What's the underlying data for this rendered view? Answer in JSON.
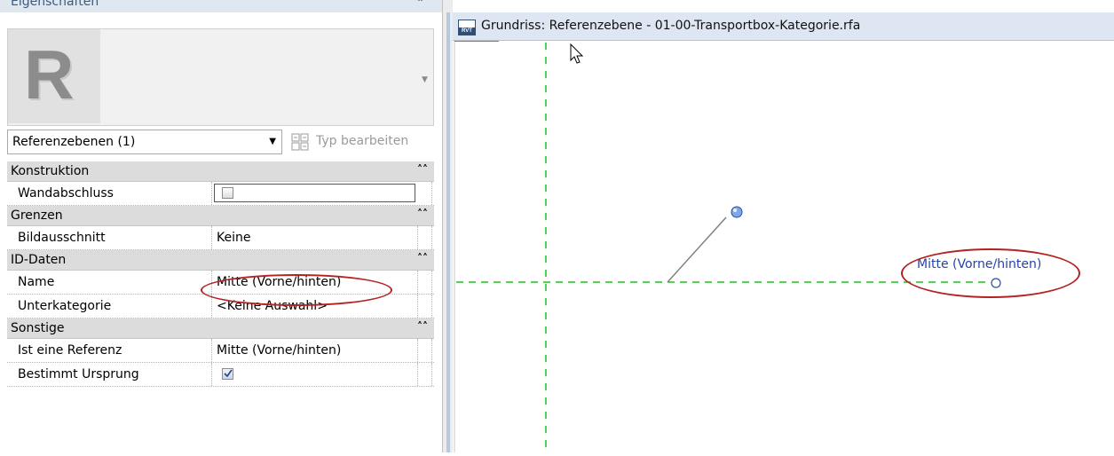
{
  "properties_panel": {
    "title": "Eigenschaften",
    "type_selector": {
      "value": "Referenzebenen (1)"
    },
    "edit_type_label": "Typ bearbeiten",
    "groups": [
      {
        "name": "Konstruktion",
        "rows": [
          {
            "name": "Wandabschluss",
            "checked": false
          }
        ]
      },
      {
        "name": "Grenzen",
        "rows": [
          {
            "name": "Bildausschnitt",
            "value": "Keine"
          }
        ]
      },
      {
        "name": "ID-Daten",
        "rows": [
          {
            "name": "Name",
            "value": "Mitte (Vorne/hinten)"
          },
          {
            "name": "Unterkategorie",
            "value": "<Keine Auswahl>"
          }
        ]
      },
      {
        "name": "Sonstige",
        "rows": [
          {
            "name": "Ist eine Referenz",
            "value": "Mitte (Vorne/hinten)"
          },
          {
            "name": "Bestimmt Ursprung",
            "checked": true
          }
        ]
      }
    ]
  },
  "view": {
    "title": "Grundriss: Referenzebene - 01-00-Transportbox-Kategorie.rfa",
    "icon_text": "RVT",
    "reference_label": "Mitte (Vorne/hinten)",
    "colors": {
      "reference_plane": "#1fc21f",
      "label": "#2343a8",
      "highlight": "#b52222"
    }
  }
}
